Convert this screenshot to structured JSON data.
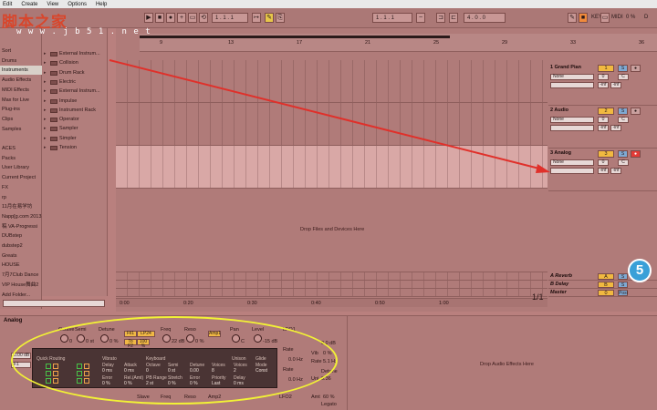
{
  "menu": [
    "Edit",
    "Create",
    "View",
    "Options",
    "Help"
  ],
  "watermark": {
    "title": "脚本之家",
    "url": "w w w . j b 5 1 . n e t"
  },
  "toolbar": {
    "position": "1 .  1 .  1",
    "loop_start": "1 .  1 .  1",
    "loop_length": "4 .  0 .  0",
    "key_label": "KEY",
    "midi_label": "MIDI",
    "cpu": "0 %",
    "d_label": "D"
  },
  "browser_left": {
    "items": [
      "Sort",
      "Drums",
      "Instruments",
      "Audio Effects",
      "MIDI Effects",
      "Max for Live",
      "Plug-ins",
      "Clips",
      "Samples",
      "",
      "ACES",
      "Packs",
      "User Library",
      "Current Project",
      "FX",
      "rp",
      "11月在易学坊",
      "Napp[g.com 2013.",
      "稿  VA-Progressi",
      "DUBstep",
      "dubstep2",
      "Greats",
      "HOUSE",
      "7月7Club Dance",
      "VIP House舞曲2",
      "Add Folder..."
    ],
    "selected_index": 2
  },
  "browser_right": {
    "items": [
      "External Instrum...",
      "Collision",
      "Drum Rack",
      "Electric",
      "External Instrum...",
      "Impulse",
      "Instrument Rack",
      "Operator",
      "Sampler",
      "Simpler",
      "Tension"
    ]
  },
  "ruler": {
    "bars": [
      "5",
      "9",
      "13",
      "17",
      "21",
      "25",
      "29",
      "33"
    ],
    "bars_top": [
      "9",
      "13",
      "17",
      "21",
      "25",
      "29",
      "33",
      "36"
    ]
  },
  "time_ruler": [
    "0:00",
    "0:20",
    "0:30",
    "0:40",
    "0:50",
    "1:00"
  ],
  "set_label": "Set",
  "tracks": [
    {
      "name": "1 Grand Pian",
      "number": "1",
      "solo": "S",
      "input": "None",
      "vol": "0",
      "pan": "C",
      "inf1": "-inf",
      "inf2": "-inf",
      "arm": false
    },
    {
      "name": "2 Audio",
      "number": "2",
      "solo": "S",
      "input": "None",
      "vol": "0",
      "pan": "C",
      "inf1": "-inf",
      "inf2": "-inf",
      "arm": false
    },
    {
      "name": "3 Analog",
      "number": "3",
      "solo": "S",
      "input": "None",
      "vol": "0",
      "pan": "C",
      "inf1": "-inf",
      "inf2": "-inf",
      "arm": true
    }
  ],
  "drop_text": "Drop Files and Devices Here",
  "returns": [
    {
      "name": "A Reverb",
      "letter": "A",
      "solo": "S"
    },
    {
      "name": "B Delay",
      "letter": "B",
      "solo": "S"
    },
    {
      "name": "Master",
      "letter": "0",
      "solo": "Post"
    }
  ],
  "fraction": "1/1",
  "badge": "5",
  "device": {
    "title": "Analog",
    "top_labels": [
      "Octave",
      "Semi",
      "Detune",
      "Freq",
      "Reso",
      "Pan",
      "Level",
      "LFO1"
    ],
    "top_values": [
      "0",
      "0 st",
      "0 %",
      "22 dB",
      "0 %",
      "C",
      "-15 dB"
    ],
    "chips": [
      "Fil1",
      "LP24",
      "To F2",
      "100 %",
      "Amp1"
    ],
    "left_vals": [
      "0.00 dB",
      "F1"
    ],
    "bottom_labels": [
      "Freq",
      "Reso",
      "Amp2",
      "Slave",
      "LFO2"
    ],
    "right_labels": [
      "Rate",
      "0.0 Hz",
      "Rate",
      "0.0 Hz",
      "Vib",
      "0 %",
      "Rate",
      "5.1 Hz",
      "Detune",
      "0.36",
      "Uni",
      "Amt",
      "60 %",
      "Legato"
    ],
    "gain": "0.0 dB",
    "dark": {
      "row_labels": [
        "Quick Routing",
        "Vibrato",
        "Keyboard",
        "Unison",
        "Glide"
      ],
      "col_labels": [
        "Delay",
        "Attack",
        "Octave",
        "Semi",
        "Detune",
        "Voices",
        "Voices",
        "Mode"
      ],
      "col_values": [
        "0 ms",
        "0 ms",
        "0",
        "0 st",
        "0.00",
        "8",
        "2",
        "Const"
      ],
      "row2_labels": [
        "Error",
        "Rel.(Amt)",
        "PB Range",
        "Stretch",
        "Error",
        "Priority",
        "Delay"
      ],
      "row2_values": [
        "0 %",
        "0 %",
        "2 st",
        "0 %",
        "0 %",
        "Last",
        "0 ms"
      ]
    }
  },
  "fx_drop_text": "Drop Audio Effects Here"
}
